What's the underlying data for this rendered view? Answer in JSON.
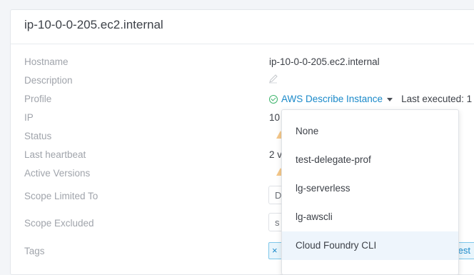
{
  "header": {
    "title": "ip-10-0-0-205.ec2.internal"
  },
  "labels": {
    "hostname": "Hostname",
    "description": "Description",
    "profile": "Profile",
    "ip": "IP",
    "status": "Status",
    "last_heartbeat": "Last heartbeat",
    "active_versions": "Active Versions",
    "scope_limited": "Scope Limited To",
    "scope_excluded": "Scope Excluded",
    "tags": "Tags"
  },
  "values": {
    "hostname": "ip-10-0-0-205.ec2.internal",
    "profile": "AWS Describe Instance",
    "last_executed": "Last executed: 1",
    "ip": "10",
    "last_heartbeat": "2 v",
    "scope_limited": "D",
    "scope_excluded": "s",
    "tag_left": "×",
    "tag_right": "test"
  },
  "dropdown": {
    "options": [
      "None",
      "test-delegate-prof",
      "lg-serverless",
      "lg-awscli",
      "Cloud Foundry CLI"
    ],
    "highlighted_index": 4
  },
  "colors": {
    "link": "#1a89c9",
    "success": "#3cb46b",
    "warning": "#f5c88a",
    "highlight": "#eef5fc"
  },
  "icons": {
    "description": "pencil-icon",
    "profile_status": "check-circle-icon",
    "profile_caret": "caret-down-icon",
    "status": "warning-icon",
    "active_versions": "warning-icon",
    "tag_remove": "close-icon"
  }
}
